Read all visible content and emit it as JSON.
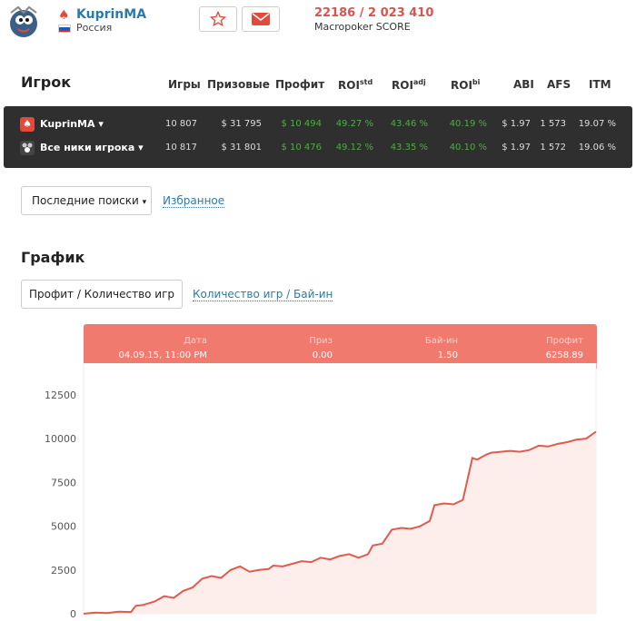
{
  "player": {
    "name": "KuprinMA",
    "country": "Россия",
    "score": "22186 / 2 023 410",
    "score_label": "Macropoker SCORE"
  },
  "table": {
    "headers": {
      "player": "Игрок",
      "games": "Игры",
      "prizes": "Призовые",
      "profit": "Профит",
      "roi_std": "ROI",
      "roi_std_sup": "std",
      "roi_adj": "ROI",
      "roi_adj_sup": "adj",
      "roi_bi": "ROI",
      "roi_bi_sup": "bi",
      "abi": "ABI",
      "afs": "AFS",
      "itm": "ITM"
    },
    "rows": [
      {
        "name": "KuprinMA",
        "games": "10 807",
        "prizes": "$ 31 795",
        "profit": "$ 10 494",
        "roi_std": "49.27 %",
        "roi_adj": "43.46 %",
        "roi_bi": "40.19 %",
        "abi": "$ 1.97",
        "afs": "1 573",
        "itm": "19.07 %"
      },
      {
        "name": "Все ники игрока",
        "games": "10 817",
        "prizes": "$ 31 801",
        "profit": "$ 10 476",
        "roi_std": "49.12 %",
        "roi_adj": "43.35 %",
        "roi_bi": "40.10 %",
        "abi": "$ 1.97",
        "afs": "1 572",
        "itm": "19.06 %"
      }
    ]
  },
  "searches": {
    "recent_label": "Последние поиски",
    "favorites_label": "Избранное"
  },
  "graph": {
    "title": "График",
    "tab_active": "Профит / Количество игр",
    "tab_other": "Количество игр / Бай-ин"
  },
  "tooltip": {
    "date_label": "Дата",
    "date_value": "04.09.15, 11:00 PM",
    "prize_label": "Приз",
    "prize_value": "0.00",
    "buyin_label": "Бай-ин",
    "buyin_value": "1.50",
    "profit_label": "Профит",
    "profit_value": "6258.89"
  },
  "colors": {
    "accent": "#e24b3b",
    "link": "#2a7ab0",
    "green": "#4caf3f",
    "line": "#e05a4e",
    "area": "#fdeeeb",
    "tooltip": "#f07a6e"
  },
  "chart_data": {
    "type": "area",
    "xlabel": "",
    "ylabel": "",
    "ylim": [
      0,
      14000
    ],
    "yticks": [
      0,
      2500,
      5000,
      7500,
      10000,
      12500
    ],
    "x": [
      0,
      250,
      500,
      750,
      1000,
      1100,
      1250,
      1500,
      1700,
      1900,
      2100,
      2300,
      2500,
      2700,
      2900,
      3100,
      3300,
      3500,
      3700,
      3900,
      4000,
      4200,
      4400,
      4600,
      4800,
      5000,
      5200,
      5400,
      5600,
      5800,
      6000,
      6100,
      6300,
      6500,
      6700,
      6900,
      7100,
      7300,
      7400,
      7600,
      7800,
      8000,
      8200,
      8300,
      8500,
      8600,
      8800,
      9000,
      9200,
      9400,
      9600,
      9800,
      10000,
      10200,
      10400,
      10600,
      10807
    ],
    "y": [
      0,
      60,
      40,
      120,
      100,
      450,
      500,
      700,
      1000,
      900,
      1300,
      1500,
      2000,
      2150,
      2050,
      2500,
      2700,
      2400,
      2500,
      2550,
      2750,
      2700,
      2850,
      3000,
      2950,
      3200,
      3100,
      3300,
      3400,
      3200,
      3400,
      3900,
      4000,
      4800,
      4900,
      4850,
      5000,
      5300,
      6200,
      6300,
      6250,
      6500,
      8900,
      8800,
      9100,
      9200,
      9250,
      9300,
      9250,
      9350,
      9600,
      9550,
      9700,
      9800,
      9950,
      10000,
      10400
    ]
  }
}
